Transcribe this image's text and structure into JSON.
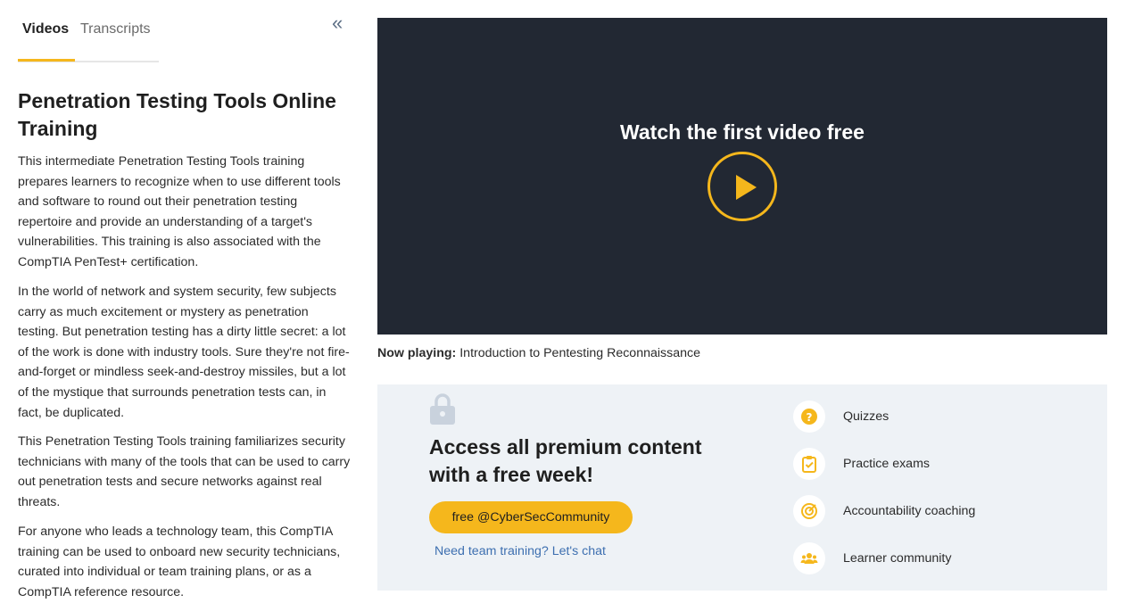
{
  "tabs": {
    "videos": "Videos",
    "transcripts": "Transcripts"
  },
  "collapse_glyph": "«",
  "course": {
    "title": "Penetration Testing Tools Online Training",
    "paragraphs": [
      "This intermediate Penetration Testing Tools training prepares learners to recognize when to use different tools and software to round out their penetration testing repertoire and provide an understanding of a target's vulnerabilities. This training is also associated with the CompTIA PenTest+ certification.",
      "In the world of network and system security, few subjects carry as much excitement or mystery as penetration testing. But penetration testing has a dirty little secret: a lot of the work is done with industry tools. Sure they're not fire-and-forget or mindless seek-and-destroy missiles, but a lot of the mystique that surrounds penetration tests can, in fact, be duplicated.",
      "This Penetration Testing Tools training familiarizes security technicians with many of the tools that can be used to carry out penetration tests and secure networks against real threats.",
      "For anyone who leads a technology team, this CompTIA training can be used to onboard new security technicians, curated into individual or team training plans, or as a CompTIA reference resource."
    ]
  },
  "video": {
    "overlay_title": "Watch the first video free",
    "now_playing_label": "Now playing:",
    "now_playing_title": "Introduction to Pentesting Reconnaissance"
  },
  "premium": {
    "title": "Access all premium content with a free week!",
    "cta_label": "free @CyberSecCommunity",
    "team_link": "Need team training? Let's chat",
    "features": [
      {
        "label": "Quizzes",
        "icon": "question-icon"
      },
      {
        "label": "Practice exams",
        "icon": "clipboard-check-icon"
      },
      {
        "label": "Accountability coaching",
        "icon": "target-icon"
      },
      {
        "label": "Learner community",
        "icon": "people-icon"
      }
    ]
  },
  "colors": {
    "accent": "#f5b71c",
    "video_bg": "#222833",
    "panel_bg": "#eef2f6",
    "link": "#3d6fb0"
  }
}
